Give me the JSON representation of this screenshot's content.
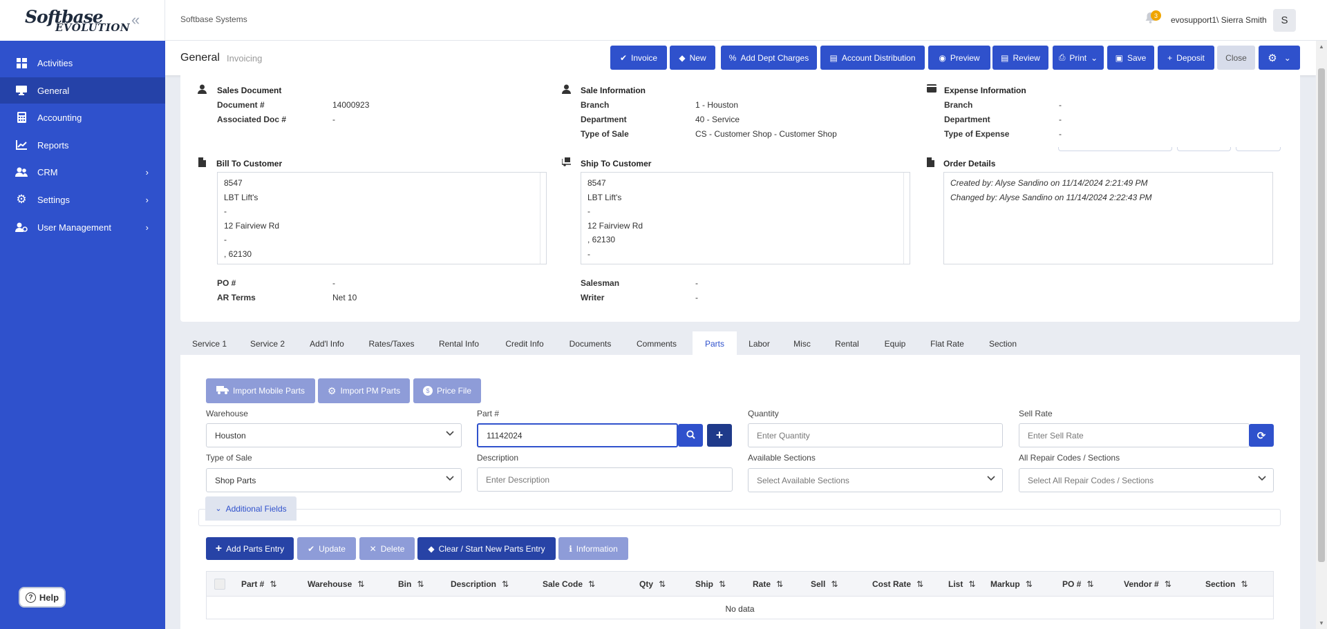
{
  "sidebar": {
    "logo_top": "Softbase",
    "logo_bottom": "EVOLUTION",
    "items": [
      {
        "label": "Activities"
      },
      {
        "label": "General"
      },
      {
        "label": "Accounting"
      },
      {
        "label": "Reports"
      },
      {
        "label": "CRM"
      },
      {
        "label": "Settings"
      },
      {
        "label": "User Management"
      }
    ],
    "help_label": "Help"
  },
  "topbar": {
    "company": "Softbase Systems",
    "notification_count": "3",
    "user": "evosupport1\\ Sierra Smith",
    "avatar_letter": "S"
  },
  "header": {
    "title": "General",
    "subtitle": "Invoicing",
    "buttons": {
      "invoice": "Invoice",
      "new": "New",
      "add_dept_charges": "Add Dept Charges",
      "account_distribution": "Account Distribution",
      "preview": "Preview",
      "review": "Review",
      "print": "Print",
      "save": "Save",
      "deposit": "Deposit",
      "close": "Close"
    }
  },
  "document": {
    "sales_document": {
      "heading": "Sales Document",
      "document_label": "Document #",
      "document_value": "14000923",
      "assoc_label": "Associated Doc #",
      "assoc_value": "-"
    },
    "sale_information": {
      "heading": "Sale Information",
      "branch_label": "Branch",
      "branch_value": "1 - Houston",
      "department_label": "Department",
      "department_value": "40 - Service",
      "type_label": "Type of Sale",
      "type_value": "CS - Customer Shop - Customer Shop"
    },
    "expense_information": {
      "heading": "Expense Information",
      "branch_label": "Branch",
      "branch_value": "-",
      "department_label": "Department",
      "department_value": "-",
      "type_label": "Type of Expense",
      "type_value": "-"
    },
    "bill_to": {
      "heading": "Bill To Customer",
      "lines": [
        "8547",
        "LBT Lift's",
        "-",
        "12 Fairview Rd",
        "-",
        ", 62130"
      ]
    },
    "ship_to": {
      "heading": "Ship To Customer",
      "lines": [
        "8547",
        "LBT Lift's",
        "-",
        "12 Fairview Rd",
        ", 62130",
        "-"
      ]
    },
    "order_details": {
      "heading": "Order Details",
      "created": "Created by: Alyse Sandino on 11/14/2024 2:21:49 PM",
      "changed": "Changed by: Alyse Sandino on 11/14/2024 2:22:43 PM"
    },
    "po_label": "PO #",
    "po_value": "-",
    "ar_terms_label": "AR Terms",
    "ar_terms_value": "Net 10",
    "salesman_label": "Salesman",
    "salesman_value": "-",
    "writer_label": "Writer",
    "writer_value": "-"
  },
  "tabs": [
    "Service 1",
    "Service 2",
    "Add'l Info",
    "Rates/Taxes",
    "Rental Info",
    "Credit Info",
    "Documents",
    "Comments",
    "Parts",
    "Labor",
    "Misc",
    "Rental",
    "Equip",
    "Flat Rate",
    "Section"
  ],
  "active_tab": "Parts",
  "parts": {
    "import_mobile": "Import Mobile Parts",
    "import_pm": "Import PM Parts",
    "price_file": "Price File",
    "warehouse_label": "Warehouse",
    "warehouse_value": "Houston",
    "part_label": "Part #",
    "part_value": "11142024",
    "quantity_label": "Quantity",
    "quantity_placeholder": "Enter Quantity",
    "sell_rate_label": "Sell Rate",
    "sell_rate_placeholder": "Enter Sell Rate",
    "type_label": "Type of Sale",
    "type_value": "Shop Parts",
    "description_label": "Description",
    "description_placeholder": "Enter Description",
    "sections_label": "Available Sections",
    "sections_placeholder": "Select Available Sections",
    "repair_label": "All Repair Codes / Sections",
    "repair_placeholder": "Select All Repair Codes / Sections",
    "additional_fields": "Additional Fields",
    "add_entry": "Add Parts Entry",
    "update": "Update",
    "delete": "Delete",
    "clear": "Clear / Start New Parts Entry",
    "information": "Information"
  },
  "grid": {
    "columns": [
      "Part #",
      "Warehouse",
      "Bin",
      "Description",
      "Sale Code",
      "Qty",
      "Ship",
      "Rate",
      "Sell",
      "Cost Rate",
      "List",
      "Markup",
      "PO #",
      "Vendor #",
      "Section"
    ],
    "sort_glyph": "⇅",
    "empty_text": "No data"
  },
  "colors": {
    "primary": "#2f51cc",
    "sidebar": "#2f51cc",
    "button_light": "#8e9cd8",
    "badge": "#f0a500"
  }
}
